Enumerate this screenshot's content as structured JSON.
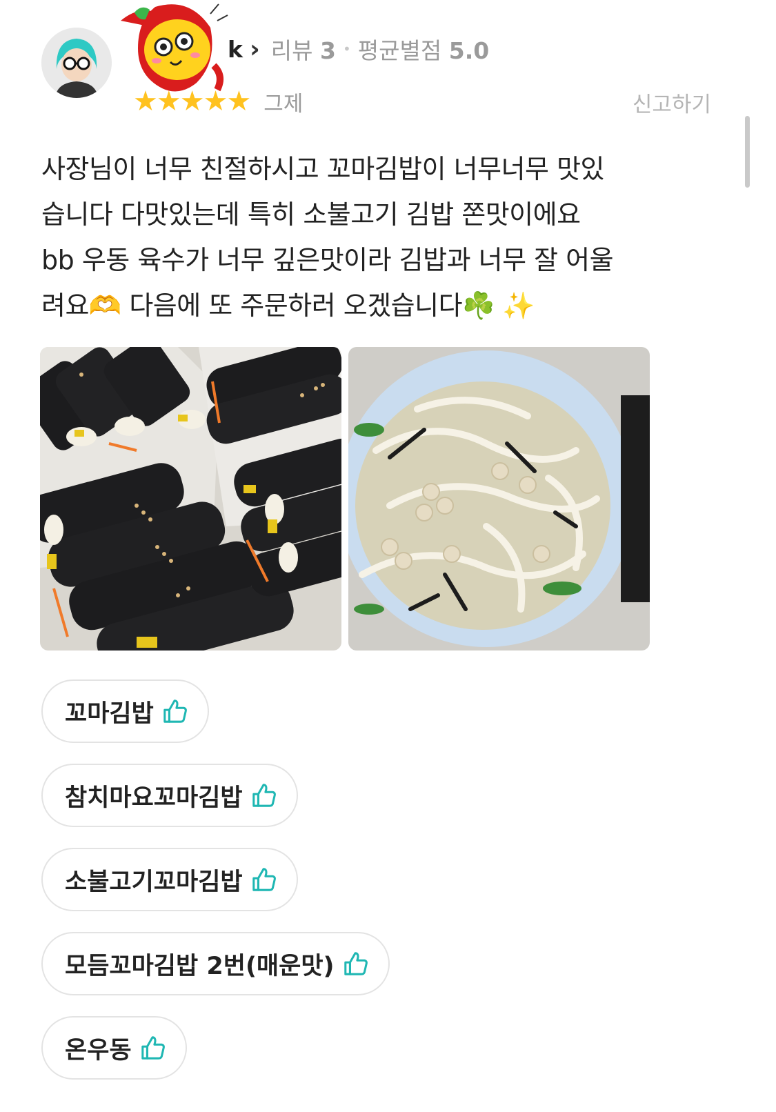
{
  "reviewer": {
    "nickname_tail": "k",
    "review_count_label": "리뷰",
    "review_count": "3",
    "avg_rating_label": "평균별점",
    "avg_rating": "5.0",
    "stars": "★★★★★",
    "date": "그제",
    "report_label": "신고하기"
  },
  "review": {
    "lines": [
      "사장님이 너무 친절하시고 꼬마김밥이 너무너무 맛있",
      "습니다 다맛있는데 특히 소불고기 김밥 쫀맛이에요",
      "bb 우동 육수가 너무 깊은맛이라 김밥과 너무 잘 어울",
      "려요🫶 다음에 또 주문하러 오겠습니다☘️ ✨"
    ]
  },
  "photos": [
    {
      "icon": "gimbap-photo"
    },
    {
      "icon": "udon-photo"
    }
  ],
  "menu_tags": [
    {
      "label": "꼬마김밥"
    },
    {
      "label": "참치마요꼬마김밥"
    },
    {
      "label": "소불고기꼬마김밥"
    },
    {
      "label": "모듬꼬마김밥 2번(매운맛)"
    },
    {
      "label": "온우동"
    }
  ],
  "colors": {
    "star": "#ffc21f",
    "thumb_accent": "#1fb7b3",
    "meta_text": "#9a9a9a"
  }
}
